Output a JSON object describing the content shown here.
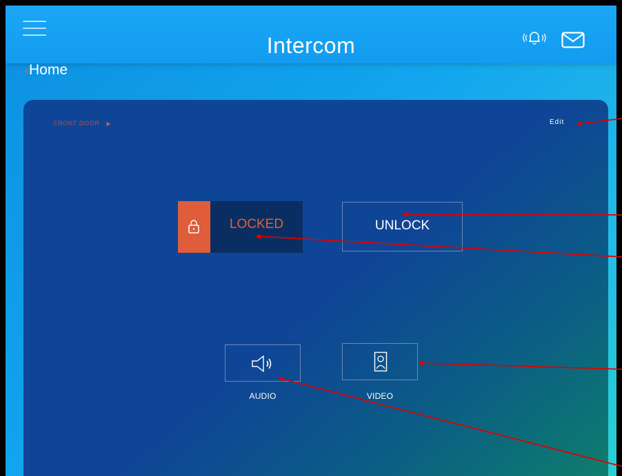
{
  "header": {
    "title": "Intercom",
    "menu_icon": "hamburger-menu-icon",
    "bell_icon": "bell-icon",
    "mail_icon": "mail-icon"
  },
  "nav": {
    "back_label": "Home"
  },
  "door": {
    "name": "FRONT DOOR",
    "edit_label": "Edit"
  },
  "lock": {
    "status_label": "LOCKED",
    "unlock_label": "UNLOCK"
  },
  "media": {
    "audio_label": "AUDIO",
    "video_label": "VIDEO"
  },
  "colors": {
    "accent": "#df5d3a",
    "panel": "#0f4596",
    "header": "#1aa6f5",
    "annotation": "#e00000"
  }
}
